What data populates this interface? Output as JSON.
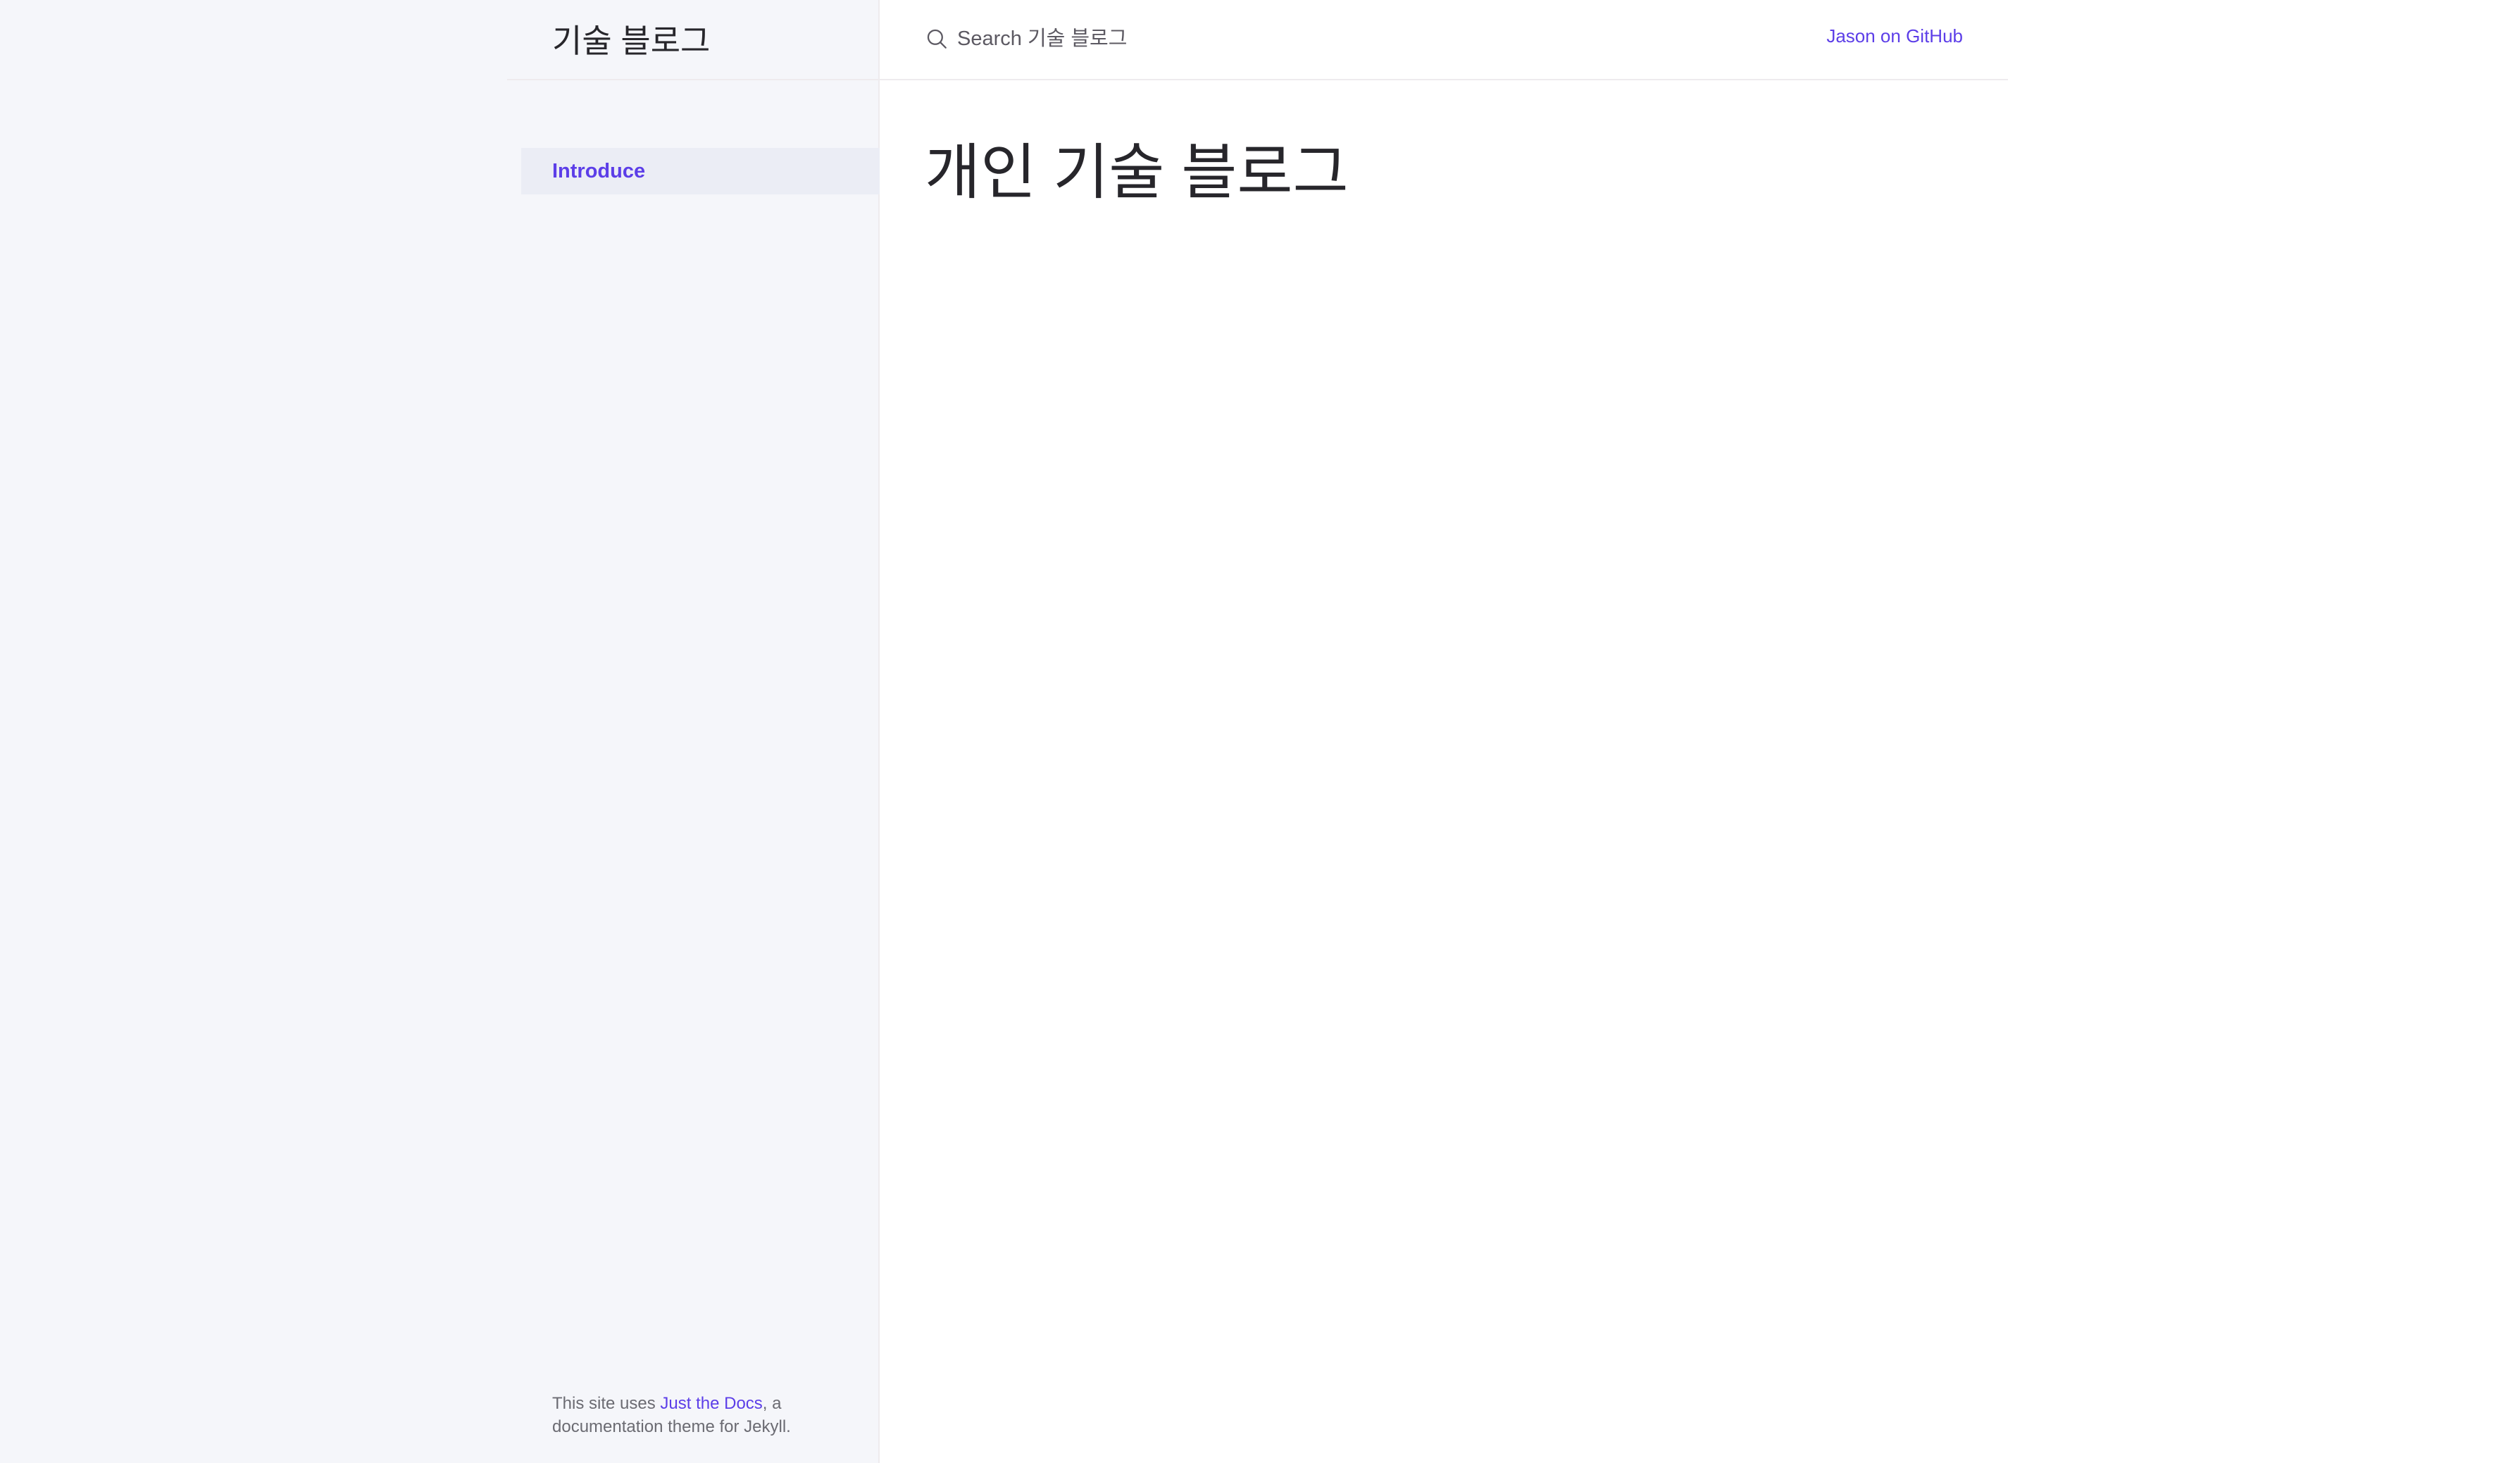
{
  "site": {
    "title": "기술 블로그"
  },
  "search": {
    "placeholder": "Search 기술 블로그",
    "icon": "search-icon"
  },
  "aux_nav": {
    "github_label": "Jason on GitHub"
  },
  "sidebar": {
    "items": [
      {
        "label": "Introduce",
        "active": true
      }
    ]
  },
  "footer": {
    "prefix": "This site uses ",
    "link_label": "Just the Docs",
    "suffix": ", a documentation theme for Jekyll."
  },
  "main": {
    "heading": "개인 기술 블로그"
  },
  "colors": {
    "accent": "#5c3ee8",
    "sidebar_bg": "#f5f6fa",
    "active_item_bg": "#ebedf5",
    "border": "#eeebee"
  }
}
